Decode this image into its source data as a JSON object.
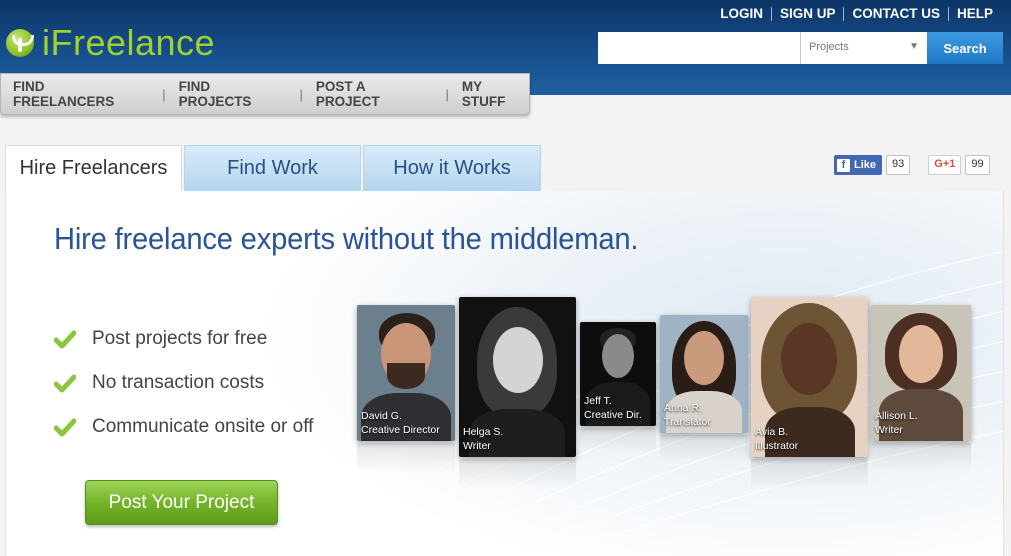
{
  "brand": {
    "name": "iFreelance"
  },
  "top_links": [
    "LOGIN",
    "SIGN UP",
    "CONTACT US",
    "HELP"
  ],
  "search": {
    "placeholder": "",
    "category": "Projects",
    "button": "Search"
  },
  "main_nav": [
    "FIND FREELANCERS",
    "FIND PROJECTS",
    "POST A PROJECT",
    "MY STUFF"
  ],
  "tabs": [
    "Hire Freelancers",
    "Find Work",
    "How it Works"
  ],
  "social": {
    "like_label": "Like",
    "like_count": "93",
    "gplus_label": "G+1",
    "gplus_count": "99"
  },
  "hero": {
    "headline": "Hire freelance experts without the middleman.",
    "features": [
      "Post projects for free",
      "No transaction costs",
      "Communicate onsite or off"
    ],
    "cta": "Post Your Project"
  },
  "freelancers": [
    {
      "name": "David G.",
      "role": "Creative Director"
    },
    {
      "name": "Helga S.",
      "role": "Writer"
    },
    {
      "name": "Jeff T.",
      "role": "Creative  Dir."
    },
    {
      "name": "Anna R.",
      "role": "Translator"
    },
    {
      "name": "Avia B.",
      "role": "Illustrator"
    },
    {
      "name": "Allison L.",
      "role": "Writer"
    }
  ],
  "colors": {
    "header_blue": "#17508f",
    "logo_green": "#9fd12f",
    "cta_green": "#75b42a",
    "headline_blue": "#2a5495"
  }
}
